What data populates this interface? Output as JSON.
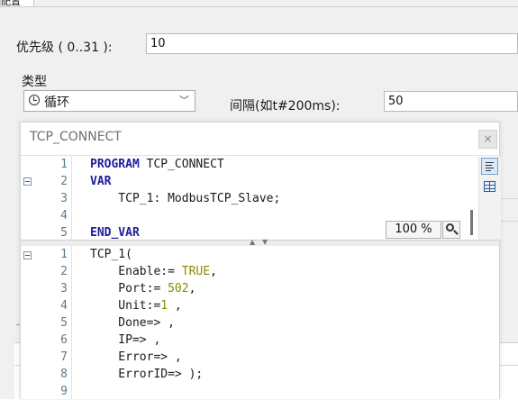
{
  "top_tab": {
    "label": "配置"
  },
  "form": {
    "priority_label": "优先级 ( 0..31 ):",
    "priority_value": "10",
    "type_label": "类型",
    "type_value": "循环",
    "interval_label": "间隔(如t#200ms):",
    "interval_value": "50"
  },
  "popup": {
    "title": "TCP_CONNECT",
    "close_glyph": "×",
    "zoom_value": "100 %",
    "declaration": {
      "line_numbers": [
        "1",
        "2",
        "3",
        "4",
        "5"
      ],
      "lines": [
        {
          "kw": "PROGRAM",
          "text": " TCP_CONNECT"
        },
        {
          "kw": "VAR",
          "text": ""
        },
        {
          "kw": "",
          "text": "    TCP_1: ModbusTCP_Slave;"
        },
        {
          "kw": "",
          "text": ""
        },
        {
          "kw": "END_VAR",
          "text": ""
        }
      ]
    },
    "body": {
      "line_numbers": [
        "1",
        "2",
        "3",
        "4",
        "5",
        "6",
        "7",
        "8",
        "9"
      ],
      "lines": [
        {
          "pre": "TCP_1(",
          "lit": "",
          "post": ""
        },
        {
          "pre": "    Enable:= ",
          "lit": "TRUE",
          "post": ","
        },
        {
          "pre": "    Port:= ",
          "lit": "502",
          "post": ","
        },
        {
          "pre": "    Unit:=",
          "lit": "1",
          "post": " ,"
        },
        {
          "pre": "    Done=> ,",
          "lit": "",
          "post": ""
        },
        {
          "pre": "    IP=> ,",
          "lit": "",
          "post": ""
        },
        {
          "pre": "    Error=> ,",
          "lit": "",
          "post": ""
        },
        {
          "pre": "    ErrorID=> );",
          "lit": "",
          "post": ""
        },
        {
          "pre": "",
          "lit": "",
          "post": ""
        }
      ]
    }
  },
  "icons": {
    "type_combo": "clock-icon",
    "zoom": "zoom-magnifier-icon",
    "side_tool_1": "text-view-icon",
    "side_tool_2": "table-view-icon"
  },
  "colors": {
    "keyword": "#1d1d9b",
    "literal": "#8a8a00",
    "line_number": "#5a7a8f",
    "active_tool": "#dbe8f7"
  }
}
